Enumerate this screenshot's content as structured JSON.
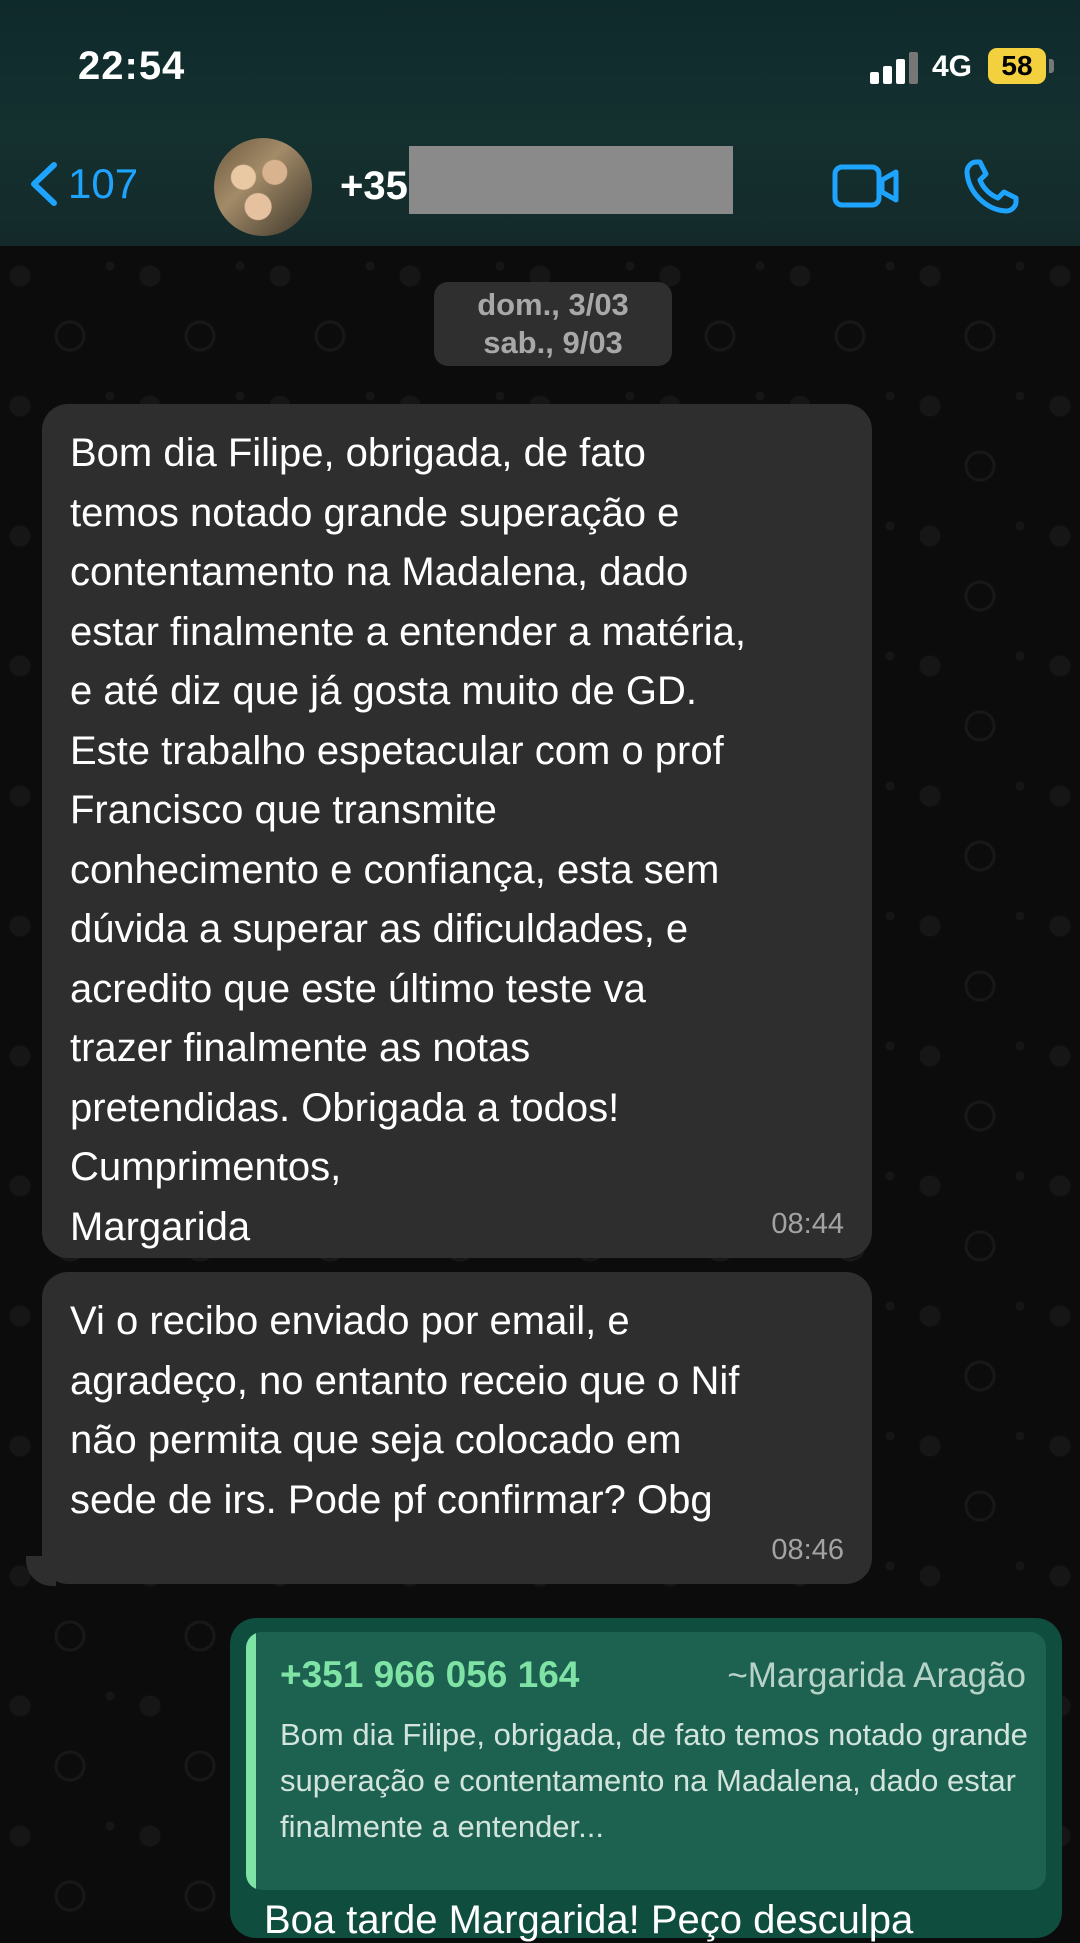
{
  "status_bar": {
    "time": "22:54",
    "network": "4G",
    "battery": "58"
  },
  "header": {
    "back_count": "107",
    "contact_name": "+35"
  },
  "date_chip": {
    "line1": "dom., 3/03",
    "line2": "sab., 9/03"
  },
  "messages": [
    {
      "text": "Bom dia Filipe, obrigada, de fato\ntemos notado grande superação e\ncontentamento na Madalena, dado\nestar finalmente a entender a matéria,\ne até diz que já gosta muito de GD.\nEste trabalho espetacular com o prof\nFrancisco que transmite\nconhecimento e confiança, esta sem\ndúvida a superar as dificuldades, e\nacredito que este último teste va\ntrazer finalmente as notas\npretendidas. Obrigada a todos!\nCumprimentos,\nMargarida",
      "time": "08:44"
    },
    {
      "text": "Vi o recibo enviado por email, e\nagradeço, no entanto receio que o Nif\nnão permita que seja colocado em\nsede de irs. Pode pf confirmar? Obg",
      "time": "08:46"
    }
  ],
  "reply": {
    "quote_phone": "+351 966 056 164",
    "quote_author": "~Margarida Aragão",
    "quote_text": "Bom dia Filipe, obrigada, de fato temos notado grande superação e contentamento na Madalena, dado estar finalmente a entender...",
    "text": "Boa tarde Margarida! Peço desculpa"
  }
}
